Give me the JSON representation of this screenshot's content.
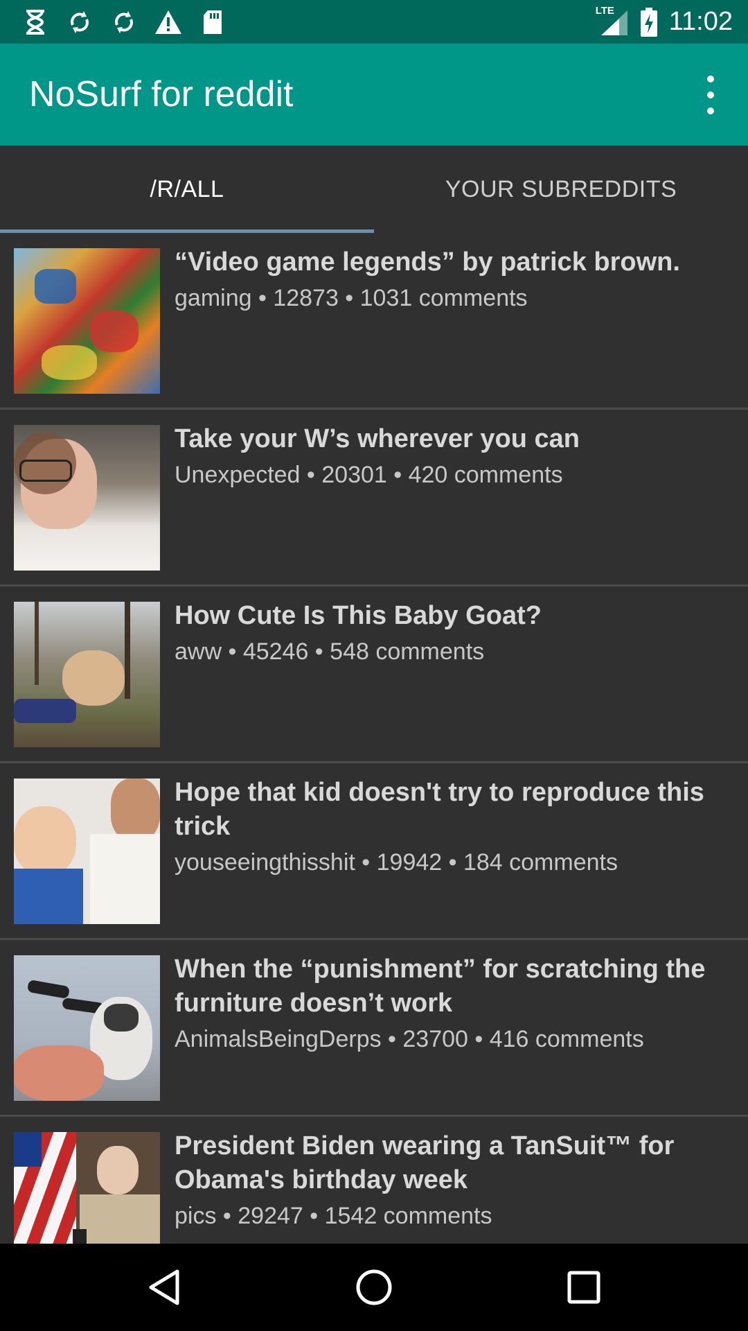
{
  "status_bar": {
    "icons_left": [
      "hourglass-icon",
      "sync-icon",
      "sync-icon",
      "warning-icon",
      "sd-card-icon"
    ],
    "network": "LTE",
    "time": "11:02"
  },
  "app_bar": {
    "title": "NoSurf for reddit",
    "menu_icon": "more-vert-icon"
  },
  "tabs": [
    {
      "label": "/R/ALL",
      "active": true
    },
    {
      "label": "YOUR SUBREDDITS",
      "active": false
    }
  ],
  "posts": [
    {
      "title": "“Video game legends” by patrick brown.",
      "meta": "gaming • 12873 • 1031 comments"
    },
    {
      "title": "Take your W’s wherever you can",
      "meta": "Unexpected • 20301 • 420 comments"
    },
    {
      "title": "How Cute Is This Baby Goat?",
      "meta": "aww • 45246 • 548 comments"
    },
    {
      "title": "Hope that kid doesn't try to reproduce this trick",
      "meta": "youseeingthisshit • 19942 • 184 comments"
    },
    {
      "title": "When the “punishment” for scratching the furniture doesn’t work",
      "meta": "AnimalsBeingDerps • 23700 • 416 comments"
    },
    {
      "title": "President Biden wearing a TanSuit™ for Obama's birthday week",
      "meta": "pics • 29247 • 1542 comments"
    }
  ],
  "nav": [
    "back-icon",
    "home-icon",
    "recents-icon"
  ],
  "colors": {
    "status_bar": "#00695c",
    "app_bar": "#009688",
    "background": "#303030",
    "tab_indicator": "#6d8fa8"
  }
}
